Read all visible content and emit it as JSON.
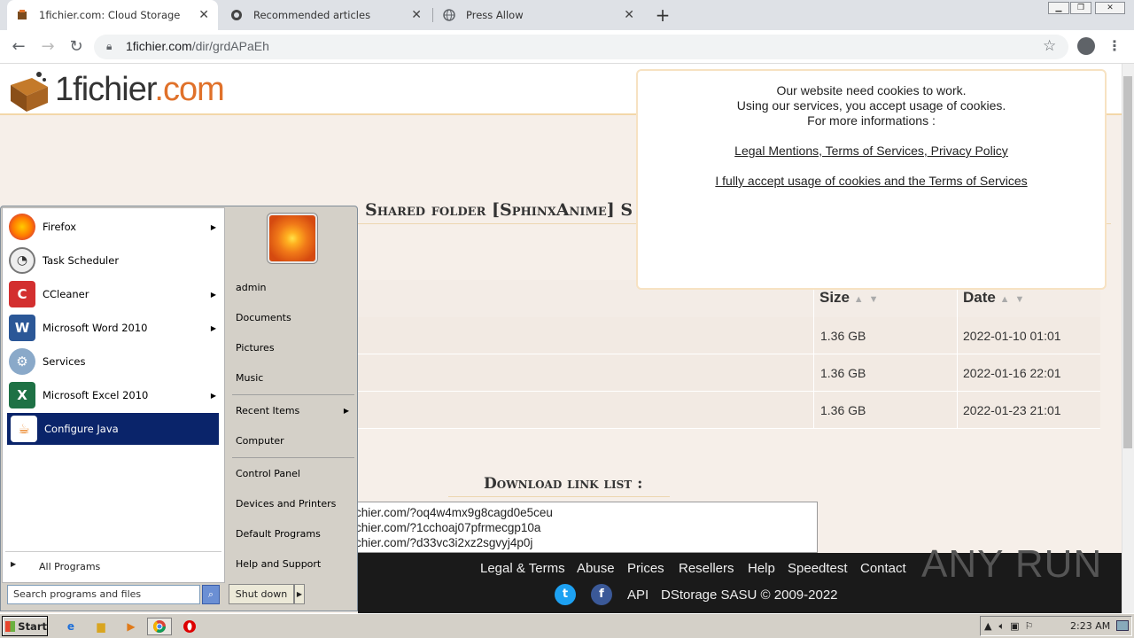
{
  "browser": {
    "tabs": [
      {
        "title": "1fichier.com: Cloud Storage",
        "active": true
      },
      {
        "title": "Recommended articles",
        "active": false
      },
      {
        "title": "Press Allow",
        "active": false
      }
    ],
    "url_host": "1fichier.com",
    "url_path": "/dir/grdAPaEh"
  },
  "site": {
    "logo_main": "1fichier",
    "logo_tld": ".com",
    "folder_title": "Shared folder [SphinxAnime] S",
    "table": {
      "headers": {
        "size": "Size",
        "date": "Date"
      },
      "rows": [
        {
          "size": "1.36 GB",
          "date": "2022-01-10 01:01"
        },
        {
          "size": "1.36 GB",
          "date": "2022-01-16 22:01"
        },
        {
          "size": "1.36 GB",
          "date": "2022-01-23 21:01"
        }
      ]
    },
    "download_title": "Download link list :",
    "download_links": [
      "chier.com/?oq4w4mx9g8cagd0e5ceu",
      "chier.com/?1cchoaj07pfrmecgp10a",
      "chier.com/?d33vc3i2xz2sgvyj4p0j"
    ],
    "footer": {
      "links": [
        "Legal & Terms",
        "Abuse",
        "Prices",
        "Resellers",
        "Help",
        "Speedtest",
        "Contact"
      ],
      "api": "API",
      "copyright": "DStorage SASU © 2009-2022"
    }
  },
  "cookie": {
    "line1": "Our website need cookies to work.",
    "line2": "Using our services, you accept usage of cookies.",
    "line3": "For more informations :",
    "links": "Legal Mentions, Terms of Services, Privacy Policy",
    "accept": "I fully accept usage of cookies and the Terms of Services"
  },
  "start_menu": {
    "programs": [
      {
        "label": "Firefox",
        "icon": "firefox-icon",
        "submenu": true
      },
      {
        "label": "Task Scheduler",
        "icon": "clock-icon",
        "submenu": false
      },
      {
        "label": "CCleaner",
        "icon": "ccleaner-icon",
        "submenu": true
      },
      {
        "label": "Microsoft Word 2010",
        "icon": "word-icon",
        "submenu": true
      },
      {
        "label": "Services",
        "icon": "gears-icon",
        "submenu": false
      },
      {
        "label": "Microsoft Excel 2010",
        "icon": "excel-icon",
        "submenu": true
      },
      {
        "label": "Configure Java",
        "icon": "java-icon",
        "submenu": false,
        "selected": true
      }
    ],
    "all_programs": "All Programs",
    "search_placeholder": "Search programs and files",
    "right": [
      "admin",
      "Documents",
      "Pictures",
      "Music",
      "Recent Items",
      "Computer",
      "Control Panel",
      "Devices and Printers",
      "Default Programs",
      "Help and Support"
    ],
    "shutdown": "Shut down"
  },
  "taskbar": {
    "start": "Start",
    "clock": "2:23 AM"
  },
  "watermark": "ANY RUN"
}
